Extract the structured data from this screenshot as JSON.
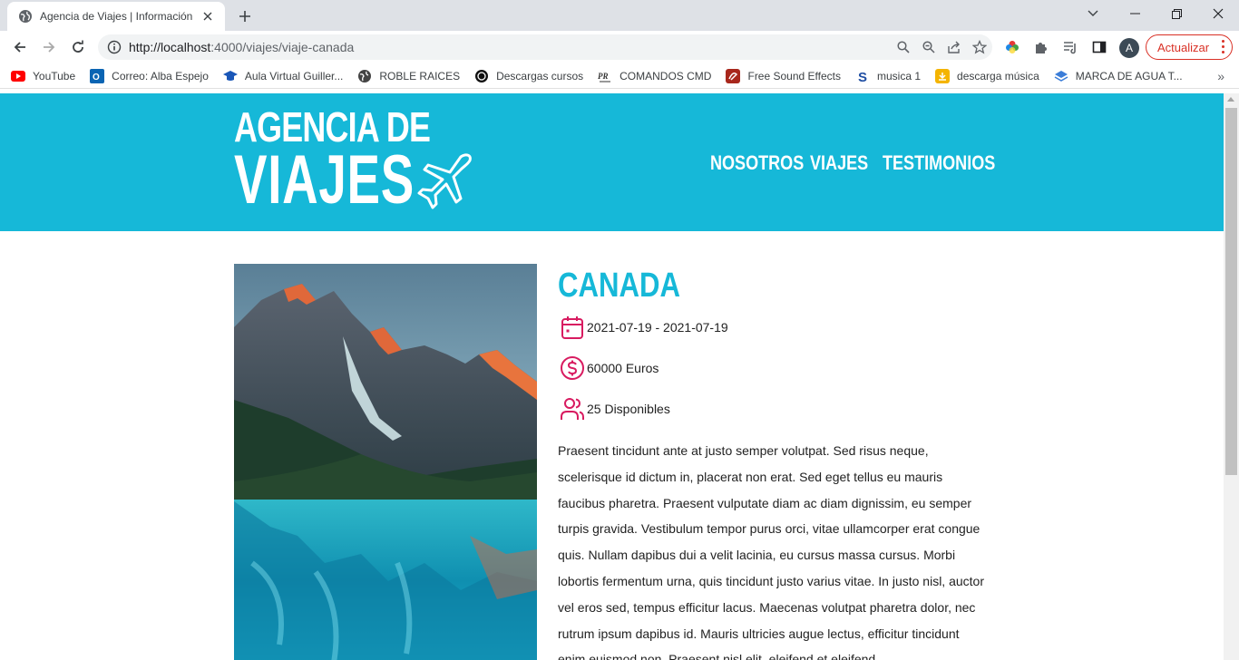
{
  "browser": {
    "tab_title": "Agencia de Viajes | Información d",
    "url_host": "http://localhost",
    "url_path": ":4000/viajes/viaje-canada",
    "update_label": "Actualizar",
    "avatar_letter": "A",
    "bookmarks": [
      {
        "label": "YouTube",
        "icon": "youtube-icon",
        "color": "#ff0000"
      },
      {
        "label": "Correo: Alba Espejo",
        "icon": "outlook-icon",
        "color": "#0a64b3"
      },
      {
        "label": "Aula Virtual Guiller...",
        "icon": "graduation-cap-icon",
        "color": "#1a57b8"
      },
      {
        "label": "ROBLE RAICES",
        "icon": "globe-icon",
        "color": "#444444"
      },
      {
        "label": "Descargas cursos",
        "icon": "download-circle-icon",
        "color": "#111111"
      },
      {
        "label": "COMANDOS CMD",
        "icon": "pr-icon",
        "color": "#333333"
      },
      {
        "label": "Free Sound Effects",
        "icon": "sound-effects-icon",
        "color": "#a8271c"
      },
      {
        "label": "musica 1",
        "icon": "s-icon",
        "color": "#1f4ea3"
      },
      {
        "label": "descarga música",
        "icon": "folder-download-icon",
        "color": "#f4b400"
      },
      {
        "label": "MARCA DE AGUA T...",
        "icon": "layers-icon",
        "color": "#3b7dd8"
      }
    ]
  },
  "site": {
    "logo_line1": "AGENCIA DE",
    "logo_line2": "VIAJES",
    "nav": [
      "NOSOTROS",
      "VIAJES",
      "TESTIMONIOS"
    ],
    "brand_color": "#16b8d8",
    "accent_color": "#d81b60"
  },
  "trip": {
    "title": "CANADA",
    "dates": "2021-07-19 - 2021-07-19",
    "price": "60000 Euros",
    "availability": "25 Disponibles",
    "description": "Praesent tincidunt ante at justo semper volutpat. Sed risus neque, scelerisque id dictum in, placerat non erat. Sed eget tellus eu mauris faucibus pharetra. Praesent vulputate diam ac diam dignissim, eu semper turpis gravida. Vestibulum tempor purus orci, vitae ullamcorper erat congue quis. Nullam dapibus dui a velit lacinia, eu cursus massa cursus. Morbi lobortis fermentum urna, quis tincidunt justo varius vitae. In justo nisl, auctor vel eros sed, tempus efficitur lacus. Maecenas volutpat pharetra dolor, nec rutrum ipsum dapibus id. Mauris ultricies augue lectus, efficitur tincidunt enim euismod non. Praesent nisl elit, eleifend et eleifend"
  }
}
